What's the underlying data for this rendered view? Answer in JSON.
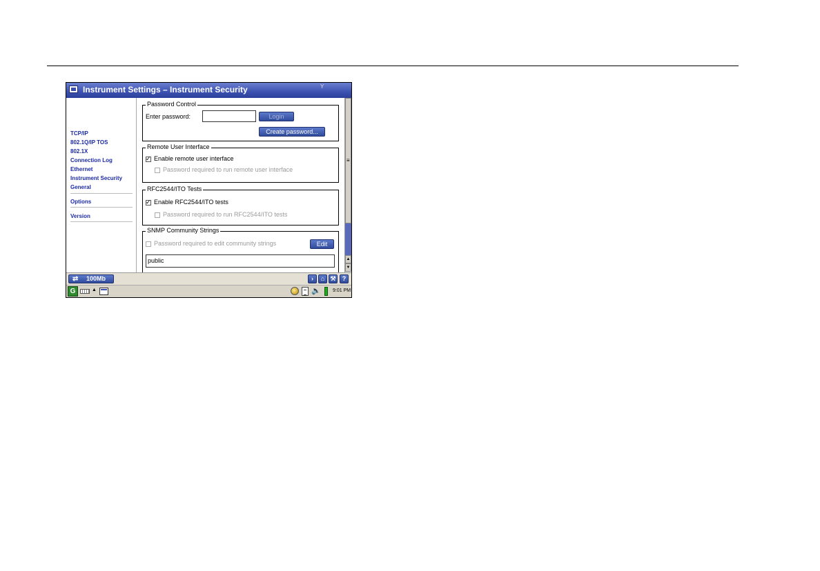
{
  "window": {
    "title": "Instrument Settings – Instrument Security",
    "signal_glyph": "Y"
  },
  "sidebar": {
    "items": [
      {
        "label": "TCP/IP"
      },
      {
        "label": "802.1Q/IP TOS"
      },
      {
        "label": "802.1X"
      },
      {
        "label": "Connection Log"
      },
      {
        "label": "Ethernet"
      },
      {
        "label": "Instrument Security"
      },
      {
        "label": "General"
      },
      {
        "label": "Options"
      },
      {
        "label": "Version"
      }
    ]
  },
  "password_control": {
    "legend": "Password Control",
    "enter_label": "Enter password:",
    "password_value": "",
    "login_label": "Login",
    "create_label": "Create password..."
  },
  "remote_ui": {
    "legend": "Remote User Interface",
    "enable_label": "Enable remote user interface",
    "enable_checked": true,
    "pw_label": "Password required to run remote user interface",
    "pw_checked": false
  },
  "rfc_tests": {
    "legend": "RFC2544/ITO Tests",
    "enable_label": "Enable RFC2544/ITO tests",
    "enable_checked": true,
    "pw_label": "Password required to run RFC2544/ITO tests",
    "pw_checked": false
  },
  "snmp": {
    "legend": "SNMP Community Strings",
    "pw_label": "Password required to edit community strings",
    "pw_checked": false,
    "edit_label": "Edit",
    "community_value": "public"
  },
  "status_bar": {
    "link_speed": "100Mb",
    "link_icon": "⇄",
    "nav_icons": [
      "forward-icon",
      "home-icon",
      "tools-icon",
      "help-icon"
    ],
    "forward_glyph": "›",
    "home_glyph": "⌂",
    "tools_glyph": "⚒",
    "help_glyph": "?"
  },
  "taskbar": {
    "start_glyph": "G",
    "clock": "9:01 PM"
  },
  "colors": {
    "titlebar": "#3c52b0",
    "nav_text": "#1c2aa6",
    "button": "#314c9c"
  }
}
